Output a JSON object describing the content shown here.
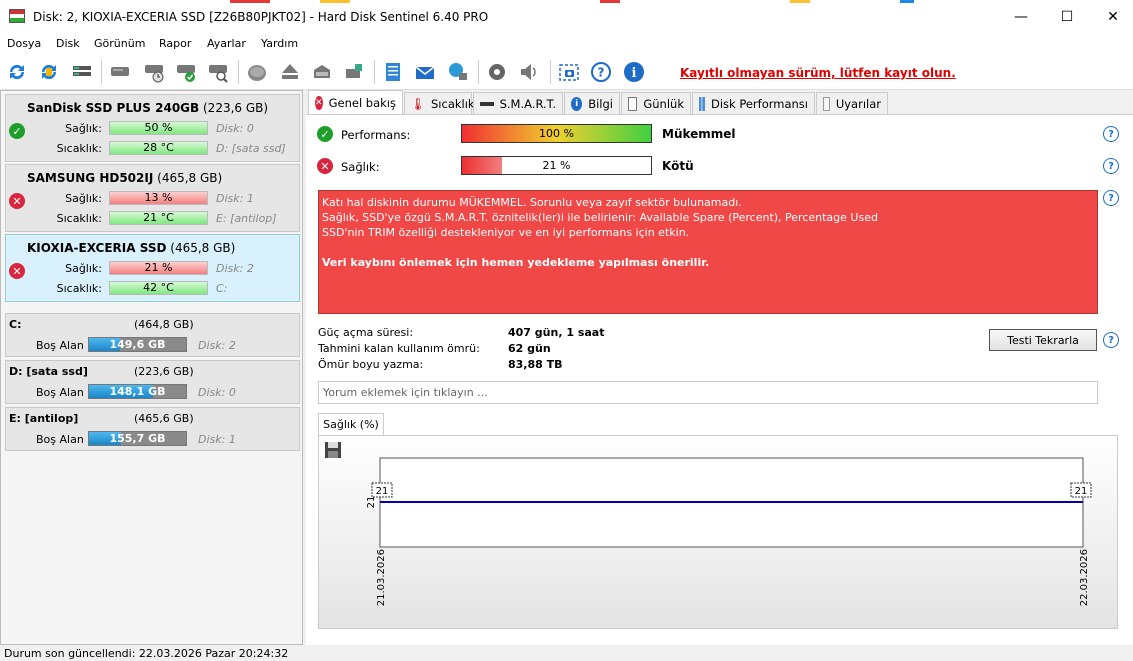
{
  "window": {
    "title": "Disk: 2, KIOXIA-EXCERIA SSD [Z26B80PJKT02]  -  Hard Disk Sentinel 6.40 PRO",
    "minimize_glyph": "—",
    "maximize_glyph": "☐",
    "close_glyph": "✕"
  },
  "menu": {
    "items": [
      "Dosya",
      "Disk",
      "Görünüm",
      "Rapor",
      "Ayarlar",
      "Yardım"
    ]
  },
  "toolbar": {
    "registration_notice": "Kayıtlı olmayan sürüm, lütfen kayıt olun."
  },
  "disks": [
    {
      "name": "SanDisk SSD PLUS 240GB",
      "size": "(223,6 GB)",
      "health_label": "Sağlık:",
      "health_value": "50 %",
      "health_fraction": 0.5,
      "health_color": "green",
      "health_ext": "Disk: 0",
      "temp_label": "Sıcaklık:",
      "temp_value": "28 °C",
      "temp_ext": "D: [sata ssd]",
      "status": "ok"
    },
    {
      "name": "SAMSUNG HD502IJ",
      "size": "(465,8 GB)",
      "health_label": "Sağlık:",
      "health_value": "13 %",
      "health_fraction": 0.13,
      "health_color": "red",
      "health_ext": "Disk: 1",
      "temp_label": "Sıcaklık:",
      "temp_value": "21 °C",
      "temp_ext": "E: [antilop]",
      "status": "bad"
    },
    {
      "name": "KIOXIA-EXCERIA SSD",
      "size": "(465,8 GB)",
      "health_label": "Sağlık:",
      "health_value": "21 %",
      "health_fraction": 0.21,
      "health_color": "red",
      "health_ext": "Disk: 2",
      "temp_label": "Sıcaklık:",
      "temp_value": "42 °C",
      "temp_ext": "C:",
      "status": "bad"
    }
  ],
  "volumes": [
    {
      "name": "C:",
      "size": "(464,8 GB)",
      "free_label": "Boş Alan",
      "free_value": "149,6 GB",
      "free_fraction": 0.32,
      "disk": "Disk: 2"
    },
    {
      "name": "D: [sata ssd]",
      "size": "(223,6 GB)",
      "free_label": "Boş Alan",
      "free_value": "148,1 GB",
      "free_fraction": 0.66,
      "disk": "Disk: 0"
    },
    {
      "name": "E: [antilop]",
      "size": "(465,6 GB)",
      "free_label": "Boş Alan",
      "free_value": "155,7 GB",
      "free_fraction": 0.33,
      "disk": "Disk: 1"
    }
  ],
  "tabs": [
    {
      "label": "Genel bakış",
      "icon": "error-icon"
    },
    {
      "label": "Sıcaklık",
      "icon": "thermometer-icon"
    },
    {
      "label": "S.M.A.R.T.",
      "icon": "smart-icon"
    },
    {
      "label": "Bilgi",
      "icon": "info-icon"
    },
    {
      "label": "Günlük",
      "icon": "log-icon"
    },
    {
      "label": "Disk Performansı",
      "icon": "performance-icon"
    },
    {
      "label": "Uyarılar",
      "icon": "alerts-icon"
    }
  ],
  "overview": {
    "performance_label": "Performans:",
    "performance_value": "100 %",
    "performance_fraction": 1.0,
    "performance_rating": "Mükemmel",
    "health_label": "Sağlık:",
    "health_value": "21 %",
    "health_fraction": 0.21,
    "health_rating": "Kötü",
    "alert_line1": "Katı hal diskinin durumu MÜKEMMEL. Sorunlu veya zayıf sektör bulunamadı.",
    "alert_line2": "Sağlık, SSD'ye özgü S.M.A.R.T. öznitelik(ler)i ile belirlenir:  Available Spare (Percent), Percentage Used",
    "alert_line3": "SSD'nin TRIM özelliği destekleniyor ve en iyi performans için etkin.",
    "alert_line4": "Veri kaybını önlemek için hemen yedekleme yapılması önerilir.",
    "power_on_label": "Güç açma süresi:",
    "power_on_value": "407 gün, 1 saat",
    "remaining_label": "Tahmini kalan kullanım ömrü:",
    "remaining_value": "62 gün",
    "lifetime_writes_label": "Ömür boyu yazma:",
    "lifetime_writes_value": "83,88 TB",
    "retest_button": "Testi Tekrarla",
    "comment_placeholder": "Yorum eklemek için tıklayın ...",
    "chart_tab": "Sağlık (%)"
  },
  "chart_data": {
    "type": "line",
    "title": "",
    "xlabel": "",
    "ylabel": "",
    "x": [
      "21.03.2026",
      "22.03.2026"
    ],
    "series": [
      {
        "values": [
          21,
          21
        ]
      }
    ],
    "y_tick_label": "21",
    "point_labels": [
      "21",
      "21"
    ],
    "line_color": "#0000b0"
  },
  "statusbar": {
    "text": "Durum son güncellendi: 22.03.2026 Pazar 20:24:32"
  }
}
